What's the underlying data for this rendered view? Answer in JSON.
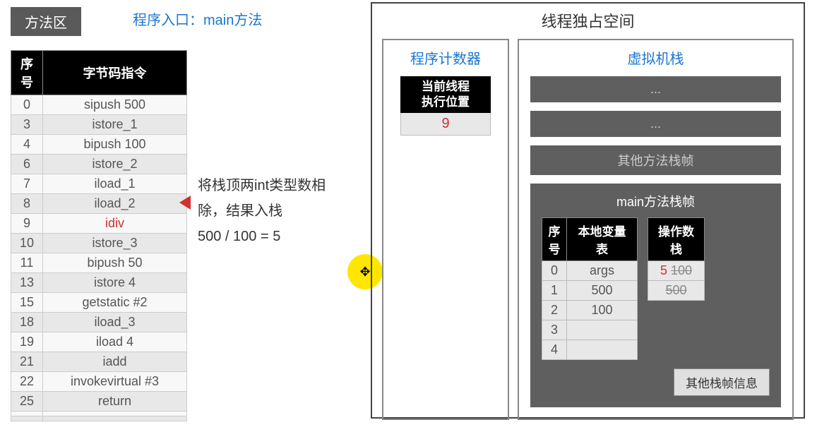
{
  "methodArea": {
    "box_label": "方法区",
    "entry_label": "程序入口：main方法"
  },
  "bytecodeTable": {
    "headers": {
      "seq": "序号",
      "instr": "字节码指令"
    },
    "rows": [
      {
        "seq": "0",
        "instr": "sipush 500",
        "hl": false
      },
      {
        "seq": "3",
        "instr": "istore_1",
        "hl": false
      },
      {
        "seq": "4",
        "instr": "bipush 100",
        "hl": false
      },
      {
        "seq": "6",
        "instr": "istore_2",
        "hl": false
      },
      {
        "seq": "7",
        "instr": "iload_1",
        "hl": false
      },
      {
        "seq": "8",
        "instr": "iload_2",
        "hl": false
      },
      {
        "seq": "9",
        "instr": "idiv",
        "hl": true
      },
      {
        "seq": "10",
        "instr": "istore_3",
        "hl": false
      },
      {
        "seq": "11",
        "instr": "bipush 50",
        "hl": false
      },
      {
        "seq": "13",
        "instr": "istore 4",
        "hl": false
      },
      {
        "seq": "15",
        "instr": "getstatic #2",
        "hl": false
      },
      {
        "seq": "18",
        "instr": "iload_3",
        "hl": false
      },
      {
        "seq": "19",
        "instr": "iload 4",
        "hl": false
      },
      {
        "seq": "21",
        "instr": "iadd",
        "hl": false
      },
      {
        "seq": "22",
        "instr": "invokevirtual #3",
        "hl": false
      },
      {
        "seq": "25",
        "instr": "return",
        "hl": false
      },
      {
        "seq": "",
        "instr": "",
        "hl": false
      },
      {
        "seq": "",
        "instr": "",
        "hl": false
      }
    ]
  },
  "explanation": {
    "line1": "将栈顶两int类型数相",
    "line2": "除，结果入栈",
    "line3": "500 / 100 = 5"
  },
  "cursor_glyph": "✥",
  "thread": {
    "title": "线程独占空间",
    "pc": {
      "title": "程序计数器",
      "label1": "当前线程",
      "label2": "执行位置",
      "value": "9"
    },
    "vmstack": {
      "title": "虚拟机栈",
      "bars": [
        "...",
        "...",
        "其他方法栈帧"
      ],
      "main_frame": {
        "title": "main方法栈帧",
        "lvt": {
          "headers": {
            "seq": "序号",
            "val": "本地变量表"
          },
          "rows": [
            {
              "seq": "0",
              "val": "args"
            },
            {
              "seq": "1",
              "val": "500"
            },
            {
              "seq": "2",
              "val": "100"
            },
            {
              "seq": "3",
              "val": ""
            },
            {
              "seq": "4",
              "val": ""
            }
          ]
        },
        "opstack": {
          "header": "操作数栈",
          "rows": [
            {
              "red": "5",
              "strike": "100"
            },
            {
              "red": "",
              "strike": "500"
            }
          ]
        },
        "other_btn": "其他栈帧信息"
      }
    }
  }
}
